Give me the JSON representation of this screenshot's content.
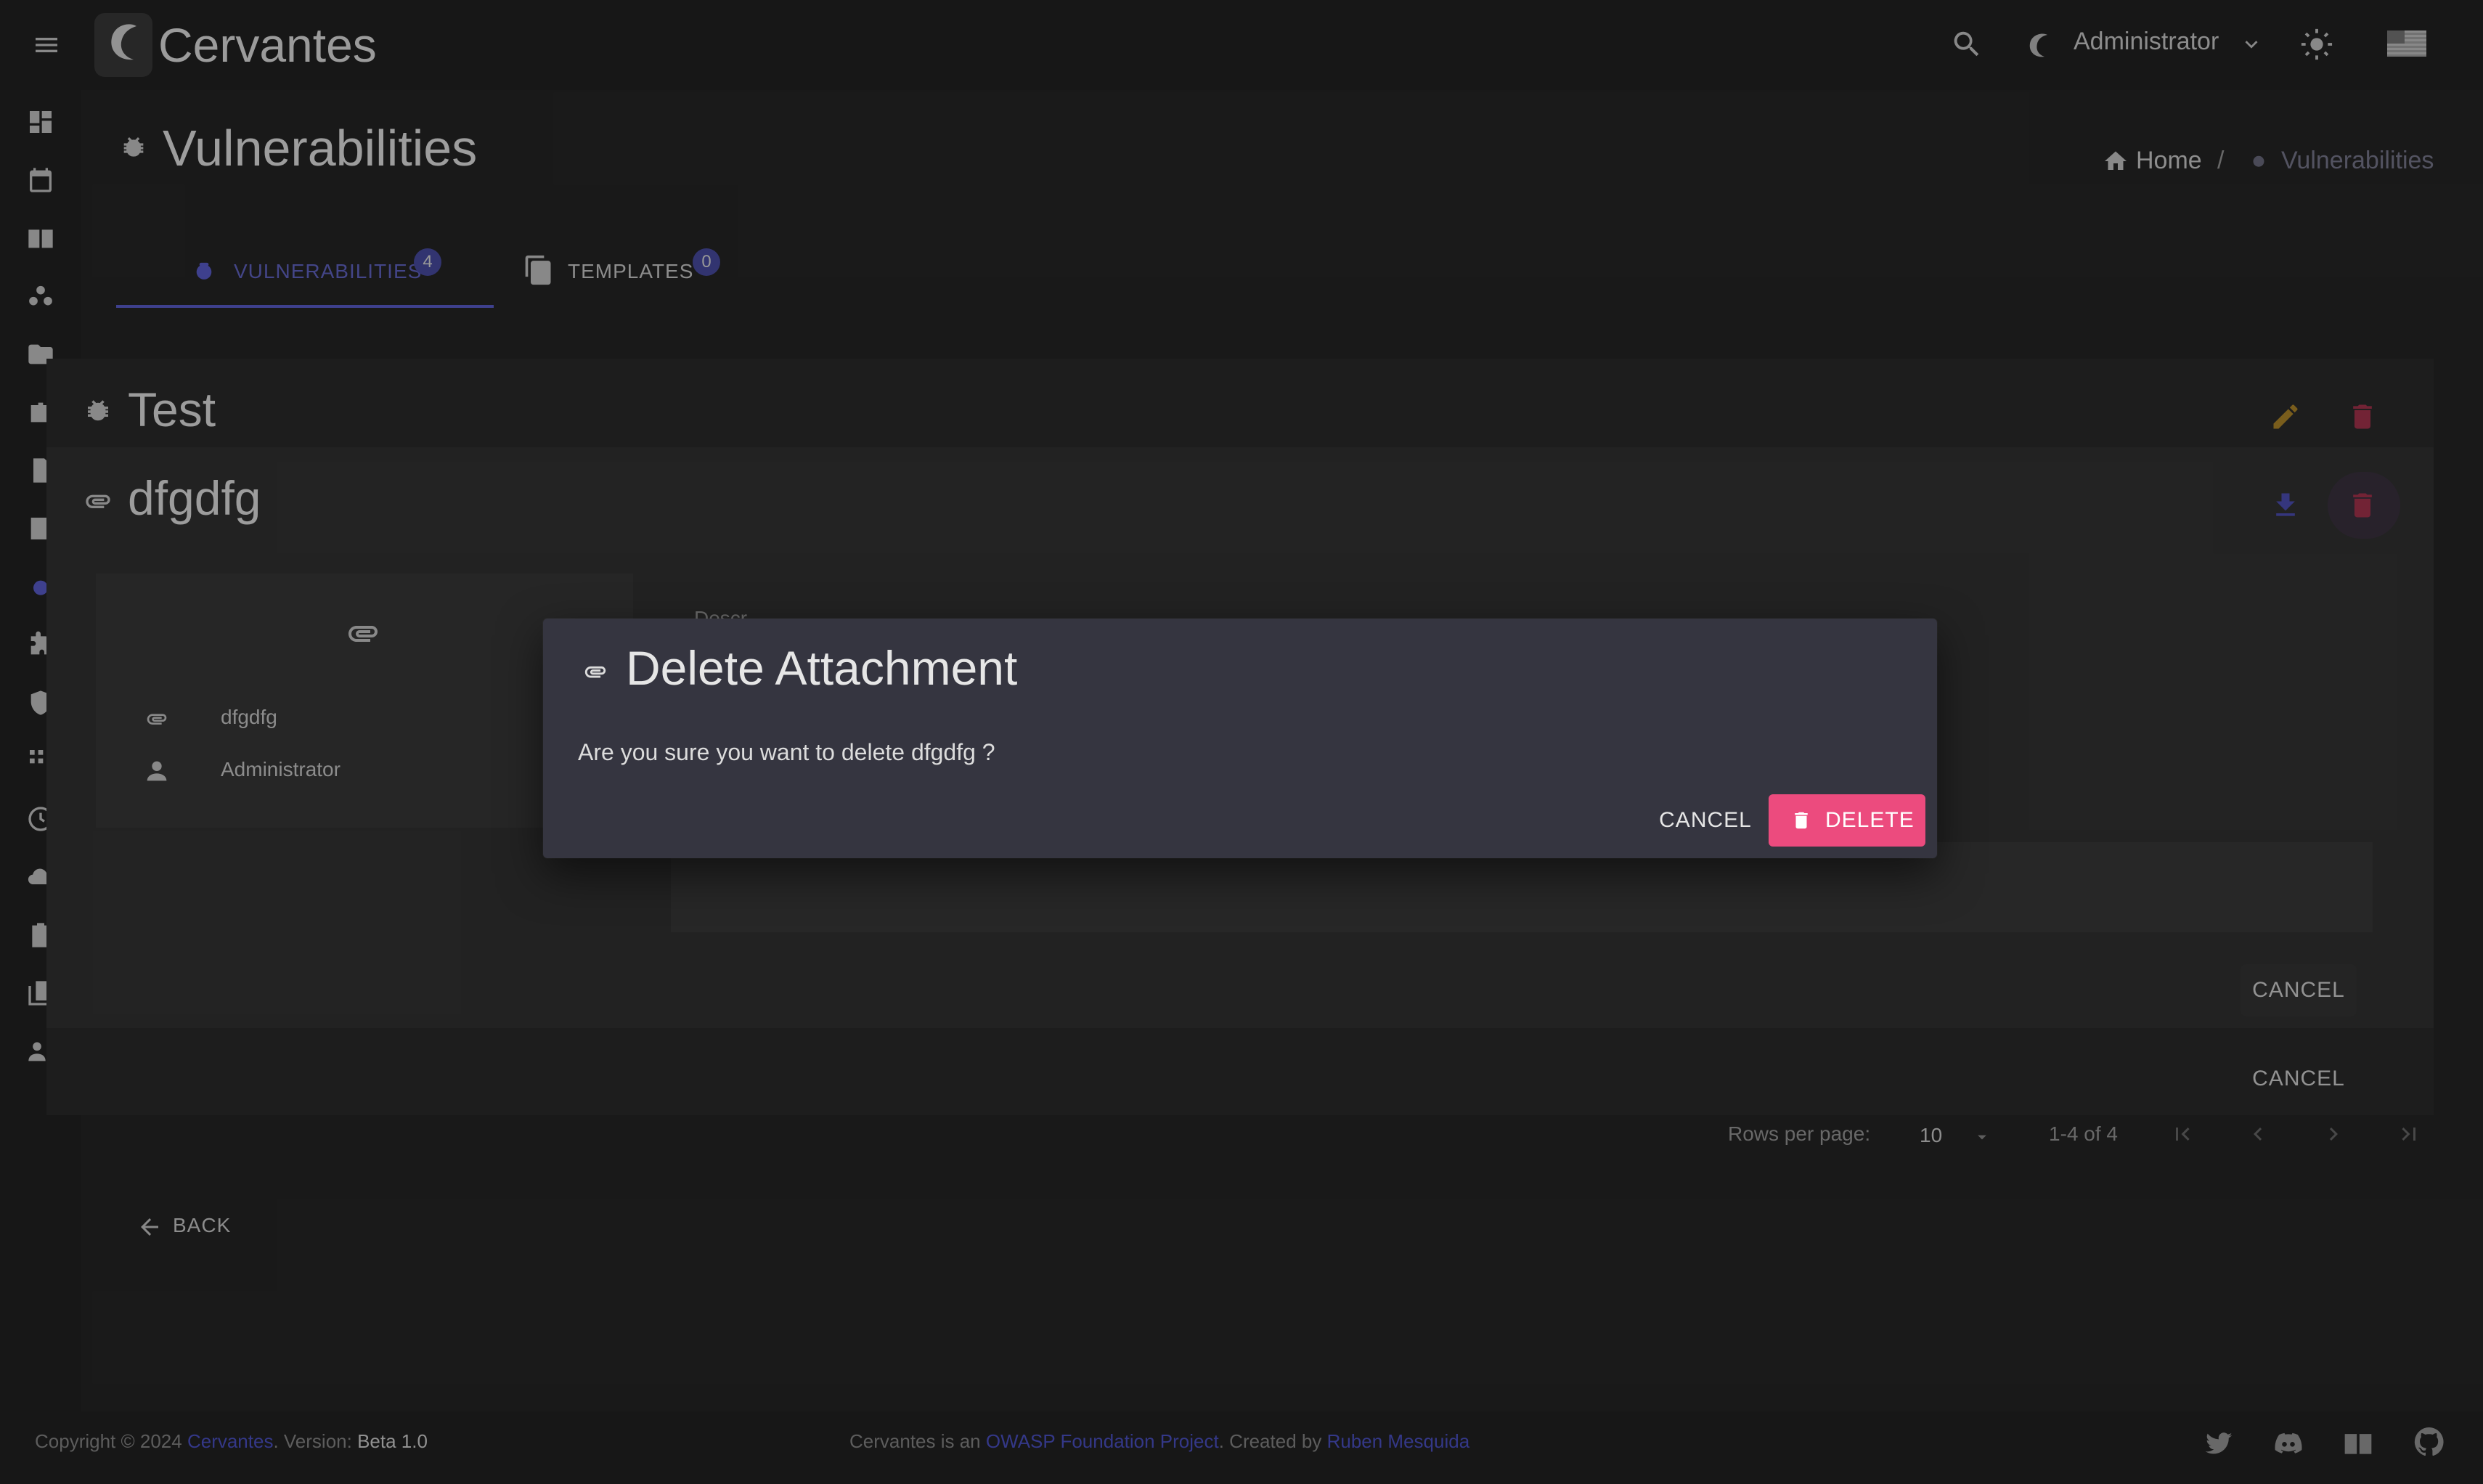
{
  "app": {
    "brand": "Cervantes"
  },
  "topbar": {
    "user_name": "Administrator"
  },
  "page": {
    "title": "Vulnerabilities"
  },
  "breadcrumb": {
    "home": "Home",
    "separator": "/",
    "current": "Vulnerabilities"
  },
  "tabs": [
    {
      "label": "VULNERABILITIES",
      "badge": "4"
    },
    {
      "label": "TEMPLATES",
      "badge": "0"
    }
  ],
  "outer_dialog": {
    "title": "Test",
    "cancel_label": "CANCEL"
  },
  "inner_dialog": {
    "title": "dfgdfg",
    "file_name": "dfgdfg",
    "user": "Administrator",
    "description_label": "Descr",
    "cancel_label": "CANCEL"
  },
  "pagination": {
    "rows_label": "Rows per page:",
    "rows_value": "10",
    "range": "1-4 of 4"
  },
  "back_label": "BACK",
  "footer": {
    "copyright": "Copyright © 2024",
    "brand_link": "Cervantes",
    "version_label": ". Version:",
    "version": "Beta 1.0",
    "project_prefix": "Cervantes is an",
    "owasp_link": "OWASP Foundation Project",
    "created_by": ". Created by",
    "author_link": "Ruben Mesquida"
  },
  "modal": {
    "title": "Delete Attachment",
    "message": "Are you sure you want to delete dfgdfg ?",
    "cancel_label": "CANCEL",
    "delete_label": "DELETE"
  },
  "colors": {
    "accent": "#5c5fd0",
    "delete": "#ec4b7e",
    "edit": "#e0a22b",
    "danger_icon": "#d4345e",
    "download": "#5d5fd6"
  }
}
